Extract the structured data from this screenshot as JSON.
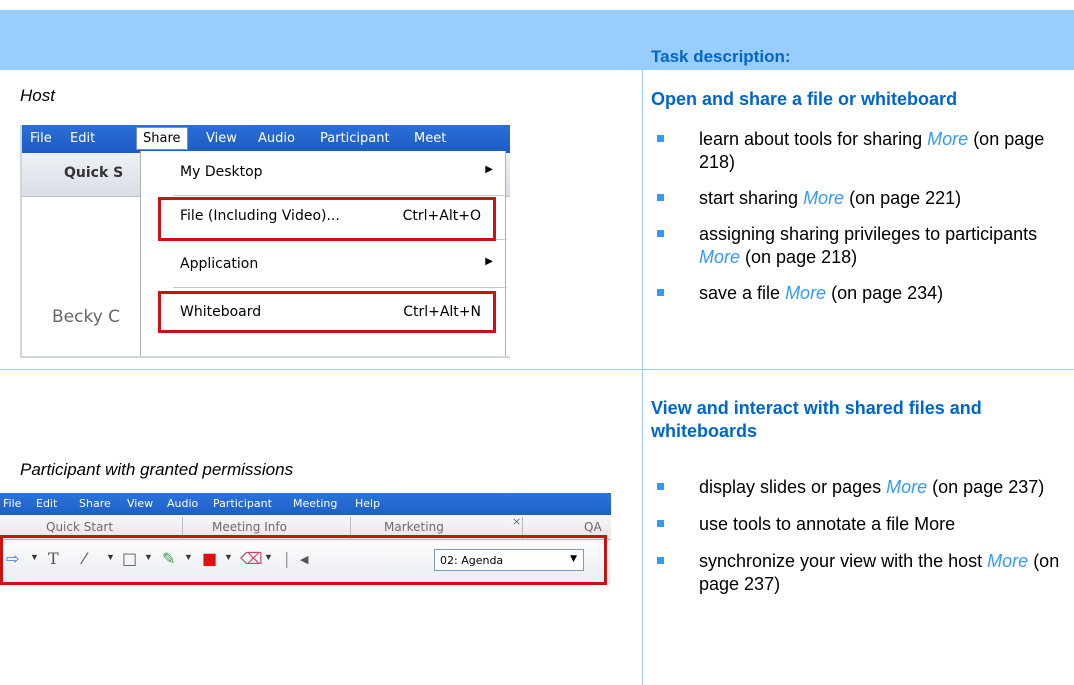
{
  "header": {
    "task_description": "Task description:"
  },
  "section1": {
    "role": "Host",
    "title": "Open and share a file or whiteboard",
    "bullets": [
      {
        "pre": "learn about tools for sharing",
        "more": "More",
        "post": "(on page 218)"
      },
      {
        "pre": "start sharing",
        "more": "More",
        "post": "(on page 221)"
      },
      {
        "pre": "assigning sharing privileges to participants",
        "more": "More",
        "post": "(on page 218)"
      },
      {
        "pre": "save a file",
        "more": "More",
        "post": "(on page 234)"
      }
    ],
    "screenshot": {
      "menu": [
        "File",
        "Edit",
        "Share",
        "View",
        "Audio",
        "Participant",
        "Meet"
      ],
      "tab_label": "Quick S",
      "body_text": "Becky C",
      "dropdown": [
        {
          "label": "My Desktop",
          "shortcut": "",
          "submenu": true
        },
        {
          "label": "File (Including Video)...",
          "shortcut": "Ctrl+Alt+O",
          "submenu": false
        },
        {
          "label": "Application",
          "shortcut": "",
          "submenu": true
        },
        {
          "label": "Whiteboard",
          "shortcut": "Ctrl+Alt+N",
          "submenu": false
        }
      ]
    }
  },
  "section2": {
    "role": "Participant with granted permissions",
    "title": "View and interact with shared files and whiteboards",
    "bullets": [
      {
        "pre": "display slides or pages",
        "more": "More",
        "post": "(on page 237)"
      },
      {
        "pre": "use tools to annotate a file More",
        "more": "",
        "post": ""
      },
      {
        "pre": "synchronize your view with the host",
        "more": "More",
        "post": "(on page 237)"
      }
    ],
    "screenshot": {
      "menu": [
        "File",
        "Edit",
        "Share",
        "View",
        "Audio",
        "Participant",
        "Meeting",
        "Help"
      ],
      "tabs": [
        "Quick Start",
        "Meeting Info",
        "Marketing",
        "QA"
      ],
      "tab_close": "×",
      "page_select": "02: Agenda"
    }
  },
  "colors": {
    "accent": "#0066cc",
    "link": "#3399ff",
    "band": "#99ccff",
    "highlight": "#cc1111"
  }
}
